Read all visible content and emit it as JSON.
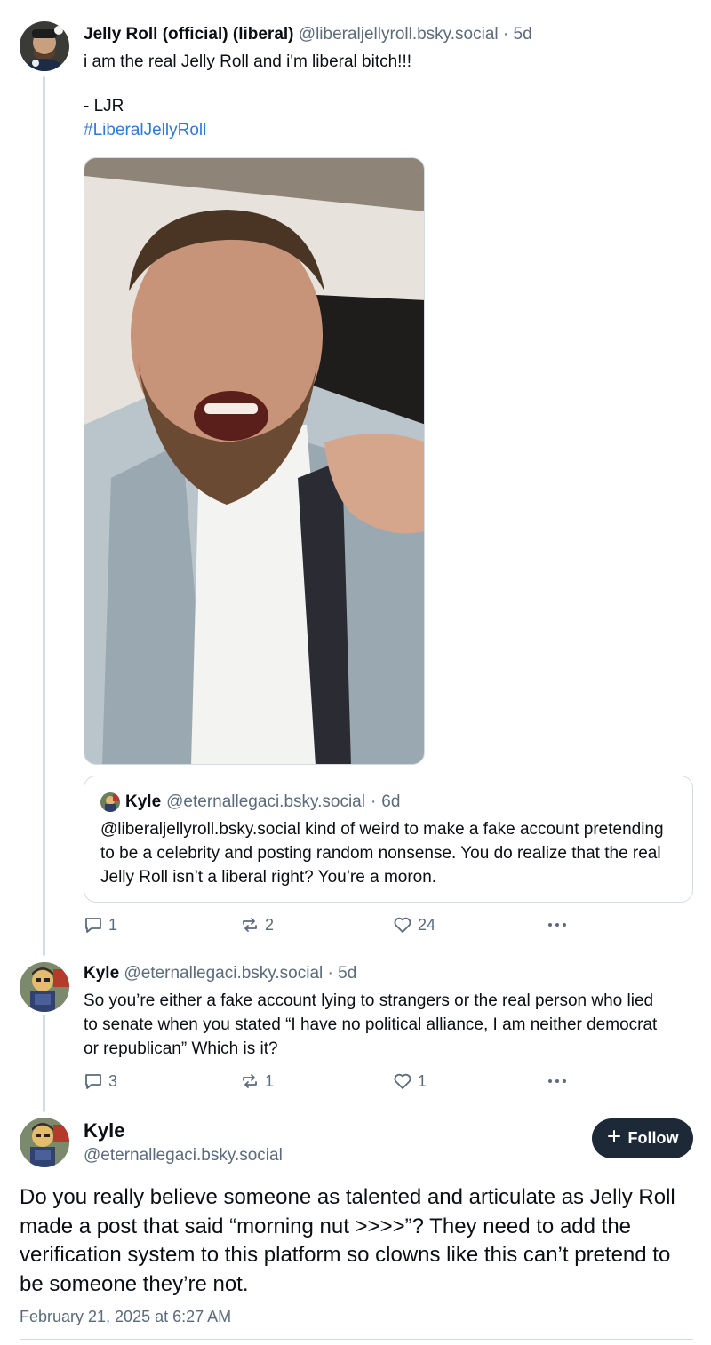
{
  "post1": {
    "name": "Jelly Roll (official) (liberal)",
    "handle": "@liberaljellyroll.bsky.social",
    "separator": "·",
    "age": "5d",
    "text_line1": "i am the real Jelly Roll and i'm liberal bitch!!!",
    "text_line2": "- LJR",
    "hashtag": "#LiberalJellyRoll",
    "quote": {
      "name": "Kyle",
      "handle": "@eternallegaci.bsky.social",
      "separator": "·",
      "age": "6d",
      "text": "@liberaljellyroll.bsky.social kind of weird to make a fake account pretending to be a celebrity and posting random nonsense. You do realize that the real Jelly Roll isn’t a liberal right? You’re a moron."
    },
    "replies": "1",
    "reposts": "2",
    "likes": "24"
  },
  "post2": {
    "name": "Kyle",
    "handle": "@eternallegaci.bsky.social",
    "separator": "·",
    "age": "5d",
    "text": "So you’re either a fake account lying to strangers or the real person who lied to senate when you stated “I have no political alliance, I am neither democrat or republican” Which is it?",
    "replies": "3",
    "reposts": "1",
    "likes": "1"
  },
  "main_post": {
    "name": "Kyle",
    "handle": "@eternallegaci.bsky.social",
    "follow_label": "Follow",
    "text": "Do you really believe someone as talented and articulate as Jelly Roll made a post that said “morning nut >>>>”? They need to add the verification system to this platform so clowns like this can’t pretend to be someone they’re not.",
    "date": "February 21, 2025 at 6:27 AM"
  },
  "icons": {
    "reply": "comment-icon",
    "repost": "repost-icon",
    "like": "heart-icon",
    "more": "more-icon",
    "follow": "plus-icon"
  },
  "colors": {
    "text": "#0b0f14",
    "muted": "#5b6b7b",
    "link": "#2f7ad8",
    "border": "#d4dbe2",
    "follow_bg": "#1e2937"
  }
}
